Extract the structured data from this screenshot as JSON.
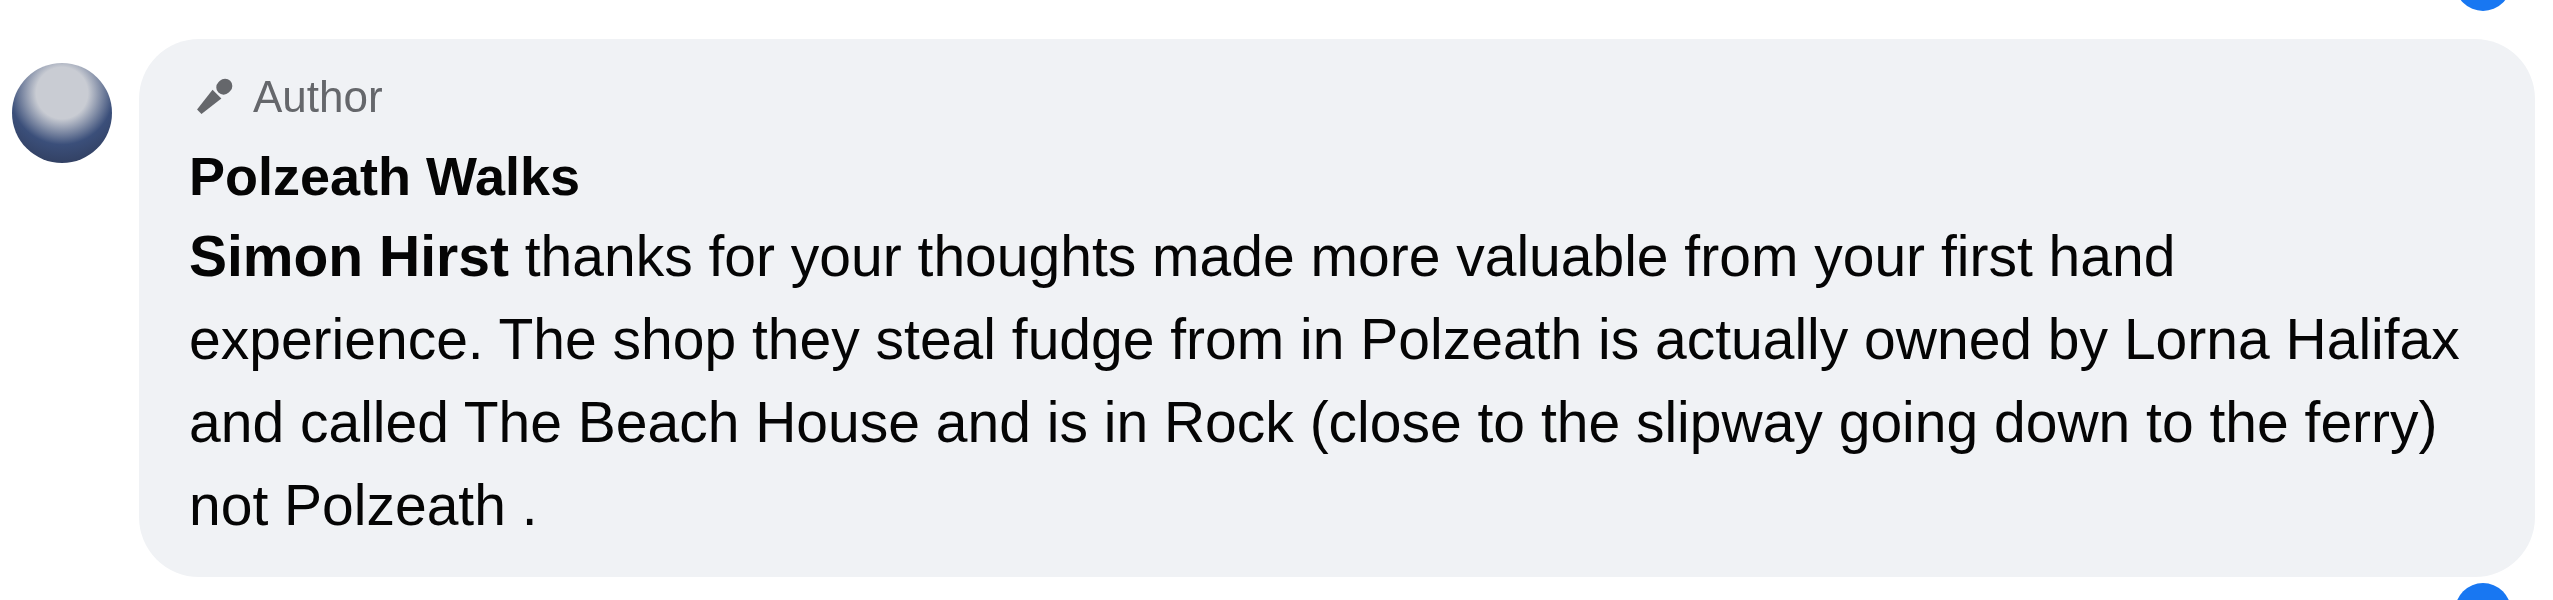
{
  "comment": {
    "badge": "Author",
    "author": "Polzeath Walks",
    "text": "**Simon Hirst** thanks for your thoughts made more valuable from your first hand experience. The shop they steal fudge from in Polzeath is actually owned by Lorna Halifax and called The Beach House and is in Rock (close to the slipway going down to the ferry) not Polzeath ."
  }
}
